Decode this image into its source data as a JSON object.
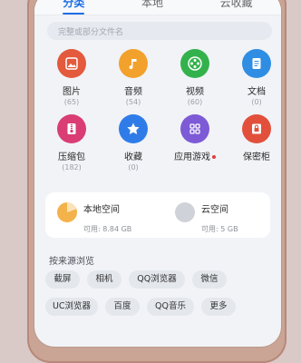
{
  "tabs": [
    "分类",
    "本地",
    "云收藏"
  ],
  "active_tab": 0,
  "search": {
    "placeholder": "完整或部分文件名"
  },
  "categories": [
    {
      "label": "图片",
      "count": "(65)",
      "icon": "image-icon",
      "color": "#e35a3d"
    },
    {
      "label": "音频",
      "count": "(54)",
      "icon": "music-icon",
      "color": "#f2a12c"
    },
    {
      "label": "视频",
      "count": "(60)",
      "icon": "video-icon",
      "color": "#33b24c"
    },
    {
      "label": "文档",
      "count": "(0)",
      "icon": "document-icon",
      "color": "#2f8ee3"
    },
    {
      "label": "压缩包",
      "count": "(182)",
      "icon": "archive-icon",
      "color": "#d93d74"
    },
    {
      "label": "收藏",
      "count": "(0)",
      "icon": "star-icon",
      "color": "#2f7ce8"
    },
    {
      "label": "应用游戏",
      "count": "",
      "icon": "apps-icon",
      "color": "#7d5ad6"
    },
    {
      "label": "保密柜",
      "count": "",
      "icon": "safe-icon",
      "color": "#e2503c"
    }
  ],
  "storage": {
    "local": {
      "name": "本地空间",
      "available": "可用: 8.84 GB",
      "color": "#f3b34a"
    },
    "cloud": {
      "name": "云空间",
      "available": "可用: 5 GB",
      "color": "#cfd2d8"
    }
  },
  "source_title": "按来源浏览",
  "sources": [
    "截屏",
    "相机",
    "QQ浏览器",
    "微信",
    "UC浏览器",
    "百度",
    "QQ音乐",
    "更多"
  ]
}
